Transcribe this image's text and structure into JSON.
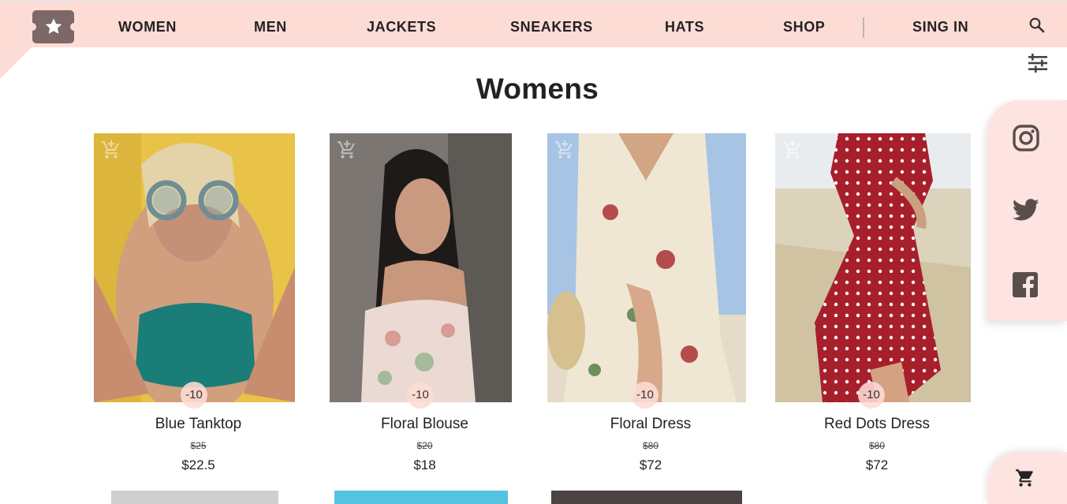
{
  "nav": {
    "logo": "star-ticket-logo",
    "links": [
      "WOMEN",
      "MEN",
      "JACKETS",
      "SNEAKERS",
      "HATS",
      "SHOP"
    ],
    "signin": "SING IN",
    "search_icon": "search-icon"
  },
  "side": {
    "filter_icon": "tune-icon",
    "social": [
      "instagram-icon",
      "twitter-icon",
      "facebook-icon"
    ],
    "cart_icon": "shopping-cart-icon"
  },
  "page": {
    "title": "Womens"
  },
  "products": [
    {
      "name": "Blue Tanktop",
      "old_price": "$25",
      "price": "$22.5",
      "discount": "-10"
    },
    {
      "name": "Floral Blouse",
      "old_price": "$20",
      "price": "$18",
      "discount": "-10"
    },
    {
      "name": "Floral Dress",
      "old_price": "$80",
      "price": "$72",
      "discount": "-10"
    },
    {
      "name": "Red Dots Dress",
      "old_price": "$80",
      "price": "$72",
      "discount": "-10"
    }
  ],
  "colors": {
    "header_bg": "#fddcd5",
    "panel_bg": "#fde4e0",
    "logo": "#7c6866",
    "icon": "#5a4e4c"
  }
}
